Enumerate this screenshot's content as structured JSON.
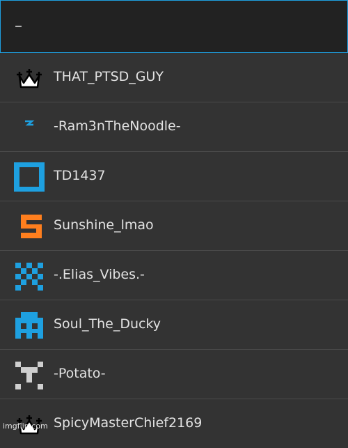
{
  "search": {
    "value": "–"
  },
  "results": [
    {
      "icon": "crown-icon",
      "name": "THAT_PTSD_GUY"
    },
    {
      "icon": "lightning-icon",
      "name": "-Ram3nTheNoodle-"
    },
    {
      "icon": "square-outline-icon",
      "name": "TD1437"
    },
    {
      "icon": "s-letter-icon",
      "name": "Sunshine_lmao"
    },
    {
      "icon": "pixel-pattern-icon",
      "name": "-.Elias_Vibes.-"
    },
    {
      "icon": "pixel-invader-icon",
      "name": "Soul_The_Ducky"
    },
    {
      "icon": "pixel-figure-icon",
      "name": "-Potato-"
    },
    {
      "icon": "crown-icon",
      "name": "SpicyMasterChief2169"
    }
  ],
  "watermark": "imgflip.com",
  "colors": {
    "accent": "#1ea0e0",
    "orange": "#ff7f1e",
    "row_bg": "#333333",
    "search_bg": "#222222"
  }
}
